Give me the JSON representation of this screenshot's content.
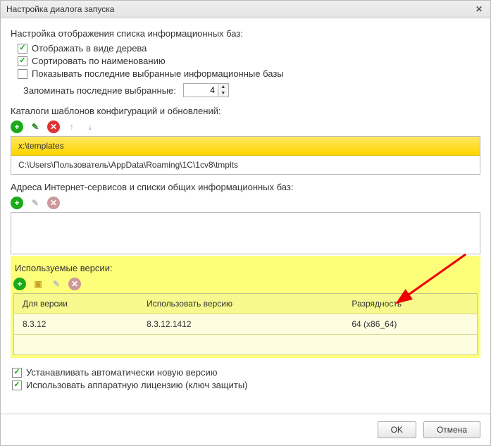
{
  "window": {
    "title": "Настройка диалога запуска"
  },
  "section1": {
    "label": "Настройка отображения списка информационных баз:",
    "opt_tree": "Отображать в виде дерева",
    "opt_sort": "Сортировать по наименованию",
    "opt_recent": "Показывать последние выбранные информационные базы",
    "remember_label": "Запоминать последние выбранные:",
    "remember_value": "4"
  },
  "templates": {
    "label": "Каталоги шаблонов конфигураций и обновлений:",
    "rows": [
      "x:\\templates",
      "C:\\Users\\Пользователь\\AppData\\Roaming\\1C\\1cv8\\tmplts"
    ]
  },
  "internet": {
    "label": "Адреса Интернет-сервисов и списки общих информационных баз:"
  },
  "versions": {
    "label": "Используемые версии:",
    "headers": {
      "for": "Для версии",
      "use": "Использовать версию",
      "bits": "Разрядность"
    },
    "rows": [
      {
        "for": "8.3.12",
        "use": "8.3.12.1412",
        "bits": "64 (x86_64)"
      }
    ]
  },
  "options": {
    "auto_update": "Устанавливать автоматически новую версию",
    "hw_license": "Использовать аппаратную лицензию (ключ защиты)"
  },
  "buttons": {
    "ok": "OK",
    "cancel": "Отмена"
  }
}
